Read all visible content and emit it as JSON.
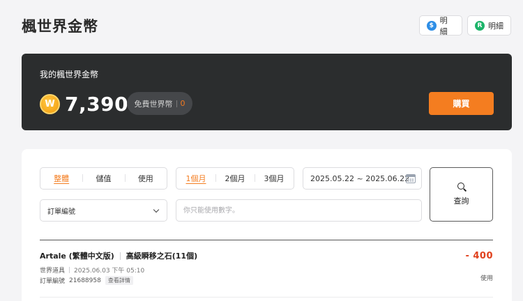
{
  "header": {
    "title": "楓世界金幣",
    "buttons": [
      {
        "icon_label": "$",
        "label": "明細",
        "icon_color": "#2e8ee6"
      },
      {
        "icon_label": "R",
        "label": "明細",
        "icon_color": "#1db46a"
      }
    ]
  },
  "balance": {
    "label": "我的楓世界金幣",
    "coin_symbol": "W",
    "amount": "7,390",
    "free_label": "免費世界幣",
    "free_value": "0",
    "buy_label": "購買"
  },
  "filters": {
    "type_tabs": [
      "整體",
      "儲值",
      "使用"
    ],
    "type_active": "整體",
    "period_tabs": [
      "1個月",
      "2個月",
      "3個月"
    ],
    "period_active": "1個月",
    "date_range": "2025.05.22 ~ 2025.06.22",
    "search_label": "查詢",
    "select_value": "訂單編號",
    "input_placeholder": "你只能使用數字。",
    "input_value": ""
  },
  "transactions": [
    {
      "game": "Artale (繁體中文版)",
      "item": "高級瞬移之石(11個)",
      "category": "世界道具",
      "datetime": "2025.06.03 下午 05:10",
      "order_label": "訂單編號",
      "order_no": "21688958",
      "detail_label": "查看詳情",
      "amount": "- 400",
      "type": "使用"
    }
  ],
  "colors": {
    "accent": "#f47d20",
    "negative": "#e0401c",
    "card_bg": "#2b2d2e"
  }
}
